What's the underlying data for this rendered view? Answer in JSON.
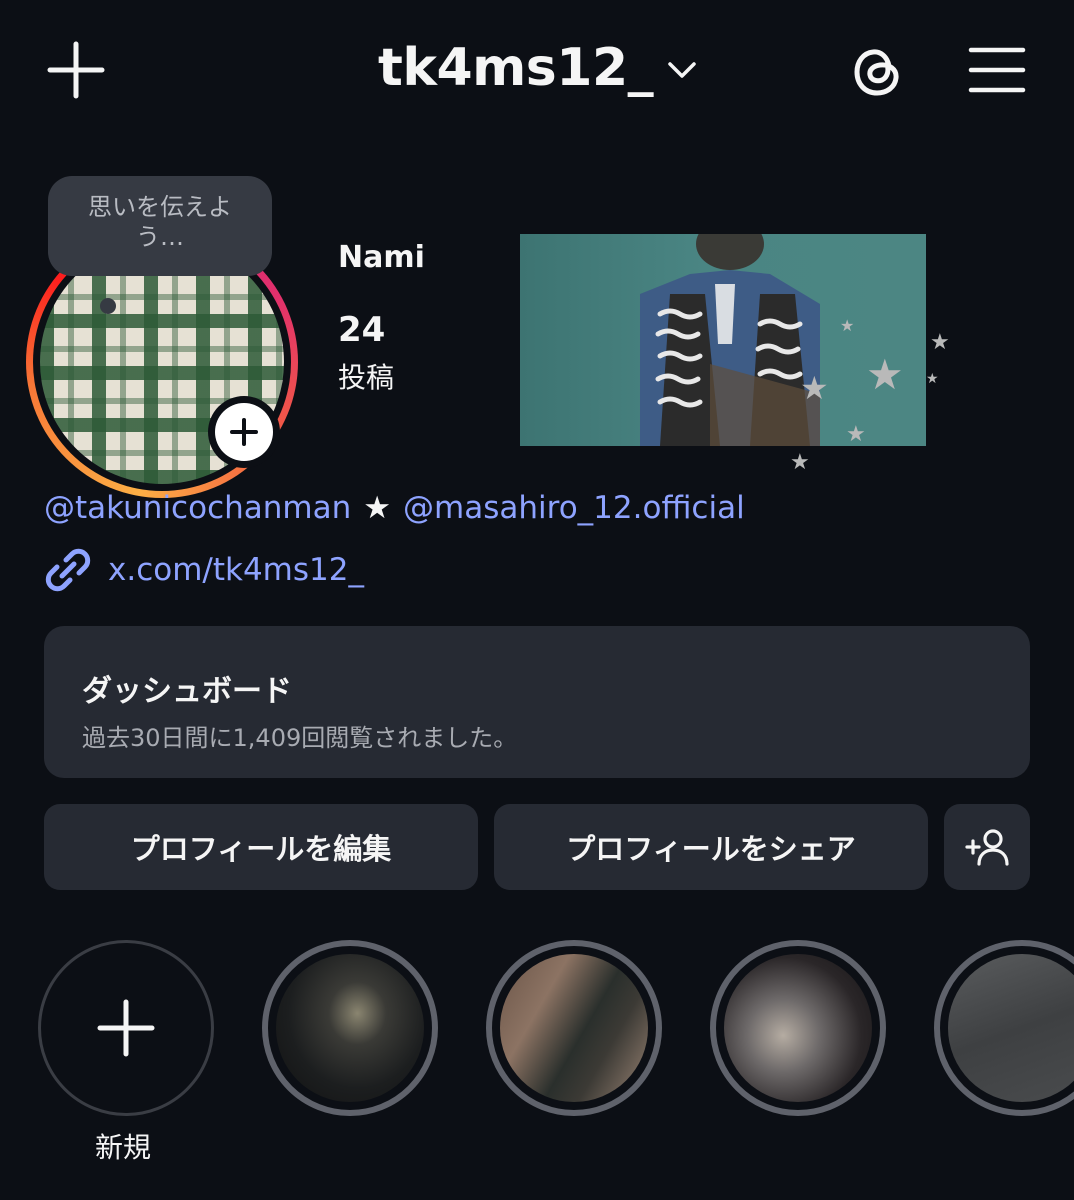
{
  "header": {
    "username": "tk4ms12_",
    "icons": [
      "plus-icon",
      "chevron-down-icon",
      "threads-icon",
      "menu-icon"
    ]
  },
  "profile": {
    "note": "思いを伝えよう…",
    "display_name": "Nami",
    "post_count": "24",
    "post_label": "投稿",
    "bio_mention_1": "@takunicochanman",
    "bio_separator": "★",
    "bio_mention_2": "@masahiro_12.official",
    "link": "x.com/tk4ms12_"
  },
  "dashboard": {
    "title": "ダッシュボード",
    "subtitle": "過去30日間に1,409回閲覧されました。"
  },
  "actions": {
    "edit_profile": "プロフィールを編集",
    "share_profile": "プロフィールをシェア"
  },
  "highlights": {
    "new_label": "新規"
  },
  "colors": {
    "background": "#0c0f15",
    "surface": "#262a33",
    "link": "#8ea3ff"
  }
}
